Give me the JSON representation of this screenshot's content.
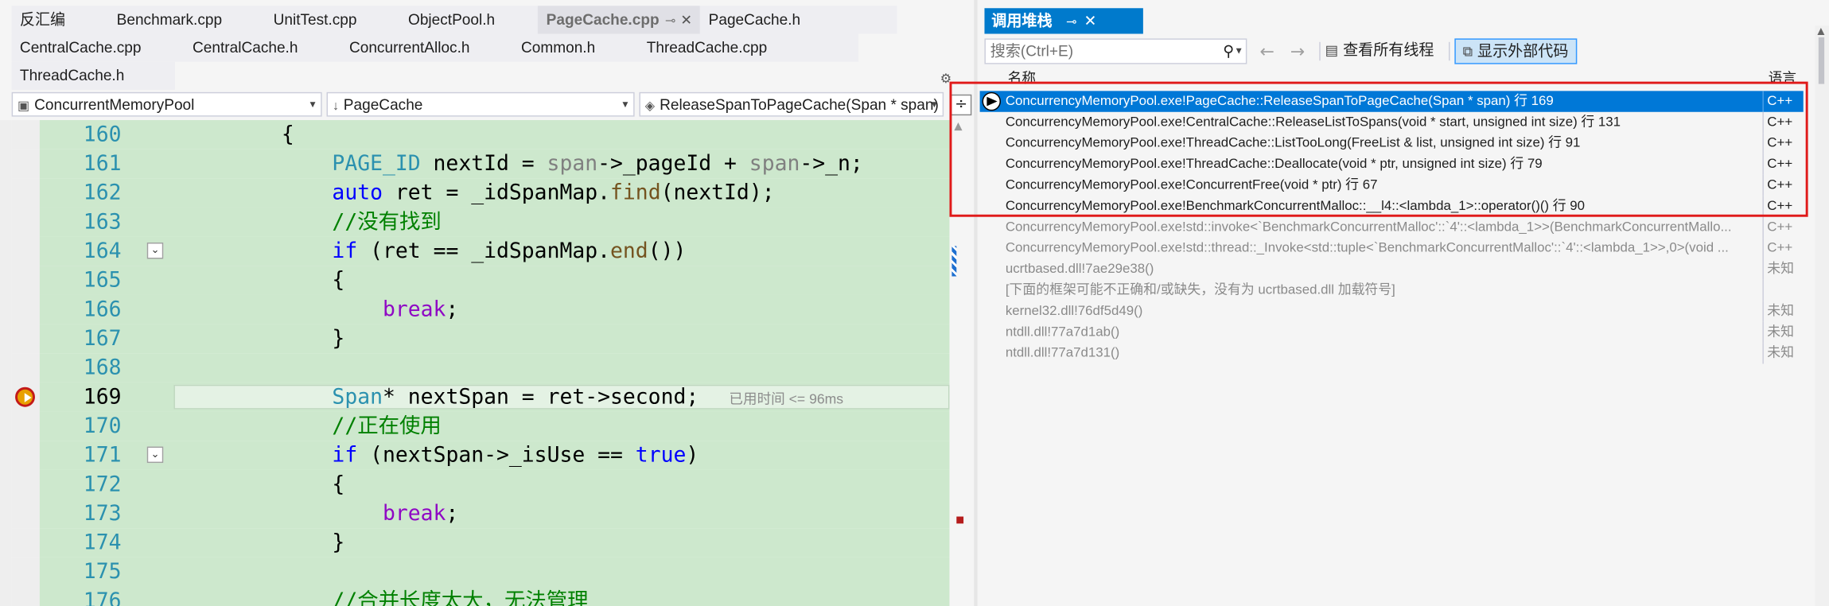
{
  "editor": {
    "tabs_row1": [
      {
        "label": "反汇编",
        "active": false
      },
      {
        "label": "Benchmark.cpp",
        "active": false
      },
      {
        "label": "UnitTest.cpp",
        "active": false
      },
      {
        "label": "ObjectPool.h",
        "active": false
      },
      {
        "label": "PageCache.cpp",
        "active": true
      },
      {
        "label": "PageCache.h",
        "active": false
      }
    ],
    "tabs_row2": [
      {
        "label": "CentralCache.cpp"
      },
      {
        "label": "CentralCache.h"
      },
      {
        "label": "ConcurrentAlloc.h"
      },
      {
        "label": "Common.h"
      },
      {
        "label": "ThreadCache.cpp"
      }
    ],
    "tabs_row3": [
      {
        "label": "ThreadCache.h"
      }
    ],
    "tab_pin_glyph": "⊸",
    "tab_close_glyph": "✕",
    "nav": {
      "project": "ConcurrentMemoryPool",
      "scope": "PageCache",
      "member": "ReleaseSpanToPageCache(Span * span)",
      "split_glyph": "÷"
    },
    "current_line": "169",
    "elapsed": "已用时间 <= 96ms",
    "lines": [
      {
        "no": "160",
        "fold": false,
        "tokens": [
          {
            "c": "",
            "t": "    {"
          }
        ]
      },
      {
        "no": "161",
        "fold": false,
        "tokens": [
          {
            "c": "",
            "t": "        "
          },
          {
            "c": "ty",
            "t": "PAGE_ID"
          },
          {
            "c": "",
            "t": " nextId = "
          },
          {
            "c": "pm",
            "t": "span"
          },
          {
            "c": "",
            "t": "->_pageId + "
          },
          {
            "c": "pm",
            "t": "span"
          },
          {
            "c": "",
            "t": "->_n;"
          }
        ]
      },
      {
        "no": "162",
        "fold": false,
        "tokens": [
          {
            "c": "",
            "t": "        "
          },
          {
            "c": "kw",
            "t": "auto"
          },
          {
            "c": "",
            "t": " ret = _idSpanMap."
          },
          {
            "c": "fn",
            "t": "find"
          },
          {
            "c": "",
            "t": "(nextId);"
          }
        ]
      },
      {
        "no": "163",
        "fold": false,
        "tokens": [
          {
            "c": "",
            "t": "        "
          },
          {
            "c": "cm",
            "t": "//没有找到"
          }
        ]
      },
      {
        "no": "164",
        "fold": true,
        "tokens": [
          {
            "c": "",
            "t": "        "
          },
          {
            "c": "kw",
            "t": "if"
          },
          {
            "c": "",
            "t": " (ret == _idSpanMap."
          },
          {
            "c": "fn",
            "t": "end"
          },
          {
            "c": "",
            "t": "())"
          }
        ]
      },
      {
        "no": "165",
        "fold": false,
        "tokens": [
          {
            "c": "",
            "t": "        {"
          }
        ]
      },
      {
        "no": "166",
        "fold": false,
        "tokens": [
          {
            "c": "",
            "t": "            "
          },
          {
            "c": "ct",
            "t": "break"
          },
          {
            "c": "",
            "t": ";"
          }
        ]
      },
      {
        "no": "167",
        "fold": false,
        "tokens": [
          {
            "c": "",
            "t": "        }"
          }
        ]
      },
      {
        "no": "168",
        "fold": false,
        "tokens": [
          {
            "c": "",
            "t": ""
          }
        ]
      },
      {
        "no": "169",
        "fold": false,
        "current": true,
        "tokens": [
          {
            "c": "",
            "t": "        "
          },
          {
            "c": "ty",
            "t": "Span"
          },
          {
            "c": "",
            "t": "* nextSpan = ret->second;"
          }
        ]
      },
      {
        "no": "170",
        "fold": false,
        "tokens": [
          {
            "c": "",
            "t": "        "
          },
          {
            "c": "cm",
            "t": "//正在使用"
          }
        ]
      },
      {
        "no": "171",
        "fold": true,
        "tokens": [
          {
            "c": "",
            "t": "        "
          },
          {
            "c": "kw",
            "t": "if"
          },
          {
            "c": "",
            "t": " (nextSpan->_isUse == "
          },
          {
            "c": "kw",
            "t": "true"
          },
          {
            "c": "",
            "t": ")"
          }
        ]
      },
      {
        "no": "172",
        "fold": false,
        "tokens": [
          {
            "c": "",
            "t": "        {"
          }
        ]
      },
      {
        "no": "173",
        "fold": false,
        "tokens": [
          {
            "c": "",
            "t": "            "
          },
          {
            "c": "ct",
            "t": "break"
          },
          {
            "c": "",
            "t": ";"
          }
        ]
      },
      {
        "no": "174",
        "fold": false,
        "tokens": [
          {
            "c": "",
            "t": "        }"
          }
        ]
      },
      {
        "no": "175",
        "fold": false,
        "tokens": [
          {
            "c": "",
            "t": ""
          }
        ]
      },
      {
        "no": "176",
        "fold": false,
        "tokens": [
          {
            "c": "",
            "t": "        "
          },
          {
            "c": "cm",
            "t": "//合并长度太大，无法管理"
          }
        ]
      }
    ]
  },
  "callstack": {
    "title": "调用堆栈",
    "pin_glyph": "⊸",
    "close_glyph": "✕",
    "search_placeholder": "搜索(Ctrl+E)",
    "search_icon": "⚲",
    "back_glyph": "←",
    "forward_glyph": "→",
    "view_all_threads": "查看所有线程",
    "show_external_code": "显示外部代码",
    "col_name": "名称",
    "col_lang": "语言",
    "frames": [
      {
        "name": "ConcurrencyMemoryPool.exe!PageCache::ReleaseSpanToPageCache(Span * span) 行 169",
        "lang": "C++",
        "selected": true,
        "external": false,
        "current": true
      },
      {
        "name": "ConcurrencyMemoryPool.exe!CentralCache::ReleaseListToSpans(void * start, unsigned int size) 行 131",
        "lang": "C++",
        "selected": false,
        "external": false
      },
      {
        "name": "ConcurrencyMemoryPool.exe!ThreadCache::ListTooLong(FreeList & list, unsigned int size) 行 91",
        "lang": "C++",
        "selected": false,
        "external": false
      },
      {
        "name": "ConcurrencyMemoryPool.exe!ThreadCache::Deallocate(void * ptr, unsigned int size) 行 79",
        "lang": "C++",
        "selected": false,
        "external": false
      },
      {
        "name": "ConcurrencyMemoryPool.exe!ConcurrentFree(void * ptr) 行 67",
        "lang": "C++",
        "selected": false,
        "external": false
      },
      {
        "name": "ConcurrencyMemoryPool.exe!BenchmarkConcurrentMalloc::__l4::<lambda_1>::operator()() 行 90",
        "lang": "C++",
        "selected": false,
        "external": false
      },
      {
        "name": "ConcurrencyMemoryPool.exe!std::invoke<`BenchmarkConcurrentMalloc'::`4'::<lambda_1>>(BenchmarkConcurrentMallo...",
        "lang": "C++",
        "selected": false,
        "external": true
      },
      {
        "name": "ConcurrencyMemoryPool.exe!std::thread::_Invoke<std::tuple<`BenchmarkConcurrentMalloc'::`4'::<lambda_1>>,0>(void ...",
        "lang": "C++",
        "selected": false,
        "external": true
      },
      {
        "name": "ucrtbased.dll!7ae29e38()",
        "lang": "未知",
        "selected": false,
        "external": true
      },
      {
        "name": "[下面的框架可能不正确和/或缺失，没有为 ucrtbased.dll 加载符号]",
        "lang": "",
        "selected": false,
        "external": true
      },
      {
        "name": "kernel32.dll!76df5d49()",
        "lang": "未知",
        "selected": false,
        "external": true
      },
      {
        "name": "ntdll.dll!77a7d1ab()",
        "lang": "未知",
        "selected": false,
        "external": true
      },
      {
        "name": "ntdll.dll!77a7d131()",
        "lang": "未知",
        "selected": false,
        "external": true
      }
    ]
  },
  "colors": {
    "accent": "#007acc",
    "selection": "#0078d7",
    "code_bg": "#cde8cd",
    "annotation_box": "#e01a1a"
  }
}
